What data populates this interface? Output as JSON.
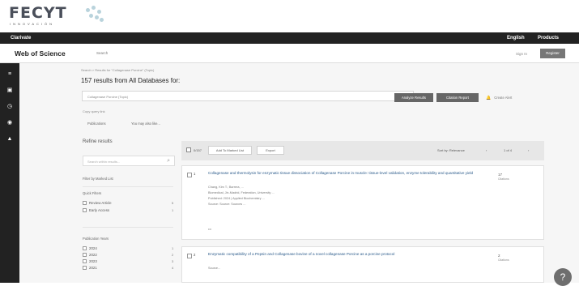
{
  "fecyt": {
    "logo": "FECYT",
    "sub": "INNOVACIÓN"
  },
  "topbar": {
    "brand": "Clarivate",
    "language": "English",
    "products": "Products"
  },
  "header": {
    "title": "Web of Science",
    "search": "Search",
    "sign_in": "Sign In",
    "register": "Register"
  },
  "rail": [
    "≡",
    "▣",
    "◷",
    "◉",
    "▲"
  ],
  "breadcrumb": "Search > Results for \"Collagenase Porcine\" (Topic)",
  "results_count": "157 results from All Databases for:",
  "query": "Collagenase Porcine (Topic)",
  "actions": {
    "analyze": "Analyze Results",
    "citation": "Citation Report",
    "alert": "Create Alert"
  },
  "copy_link": "Copy query link",
  "tabs": [
    "Publications",
    "You may also like..."
  ],
  "sidebar": {
    "refine_title": "Refine results",
    "search_placeholder": "Search within results...",
    "quick_filters": "Filter by Marked List",
    "group1": "Quick Filters",
    "items1": [
      {
        "label": "Review Article",
        "count": "5"
      },
      {
        "label": "Early Access",
        "count": "1"
      }
    ],
    "pub_years": "Publication Years",
    "years": [
      {
        "label": "2024",
        "count": "1"
      },
      {
        "label": "2022",
        "count": "2"
      },
      {
        "label": "2023",
        "count": "3"
      },
      {
        "label": "2021",
        "count": "4"
      }
    ]
  },
  "toolbar": {
    "selected": "0/157",
    "add_marked": "Add To Marked List",
    "export": "Export",
    "sort": "Sort by: Relevance",
    "page": "1 of 4"
  },
  "records": [
    {
      "num": "1",
      "title": "Collagenase and thermolysin for enzymatic tissue dissociation of Collagenase Porcine in muscle: tissue-level validation, enzyme tolerability and quantitative yield",
      "lines": [
        "Chang, Kim T.; Barrera, ...",
        "Biomedical, Jin-Madrid, Federation, University ...",
        "Published: 2024 | Applied Biochemistry ...",
        "Source: Source: Sources ..."
      ],
      "cite": "17",
      "cite_label": "Citations"
    },
    {
      "num": "2",
      "title": "Enzymatic compatibility of a Pepsin and Collagenase bovine of a novel collagenase Porcine as a porcine protocol",
      "lines": [
        "Source..."
      ],
      "cite": "2",
      "cite_label": "Citations"
    }
  ]
}
